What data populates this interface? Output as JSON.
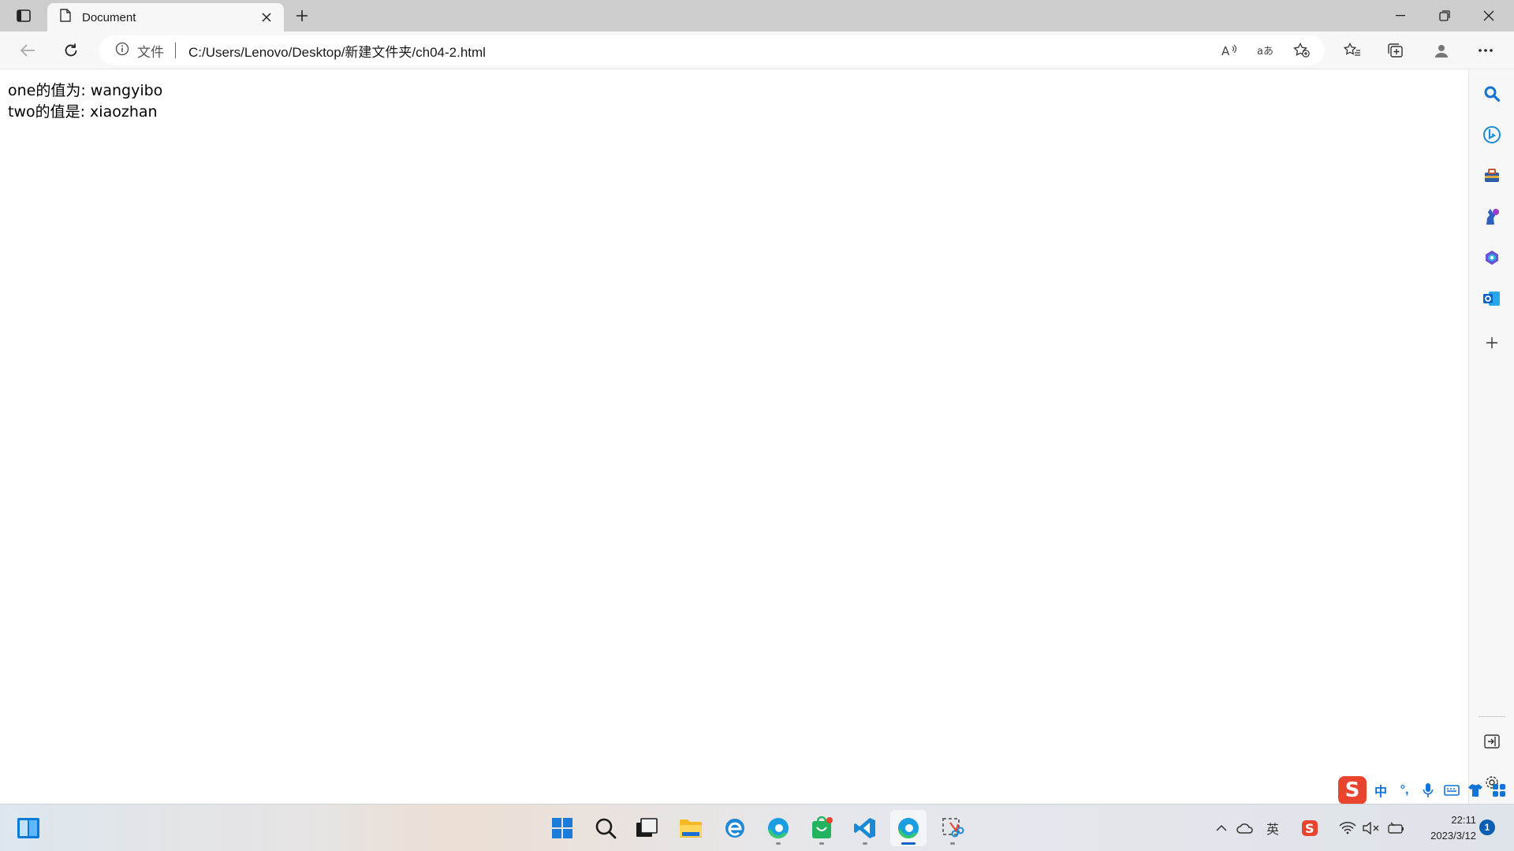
{
  "browser": {
    "tab_title": "Document",
    "address_scheme": "文件",
    "address_url": "C:/Users/Lenovo/Desktop/新建文件夹/ch04-2.html"
  },
  "content": {
    "lines": [
      "one的值为: wangyibo",
      "two的值是: xiaozhan"
    ]
  },
  "ime": {
    "mode": "中",
    "punct": "°,"
  },
  "taskbar": {
    "time": "22:11",
    "date": "2023/3/12",
    "notification_count": "1",
    "tray_lang": "英"
  },
  "colors": {
    "accent": "#0a64c8",
    "sidebar_search": "#1173d4",
    "sogou": "#e8442e"
  }
}
